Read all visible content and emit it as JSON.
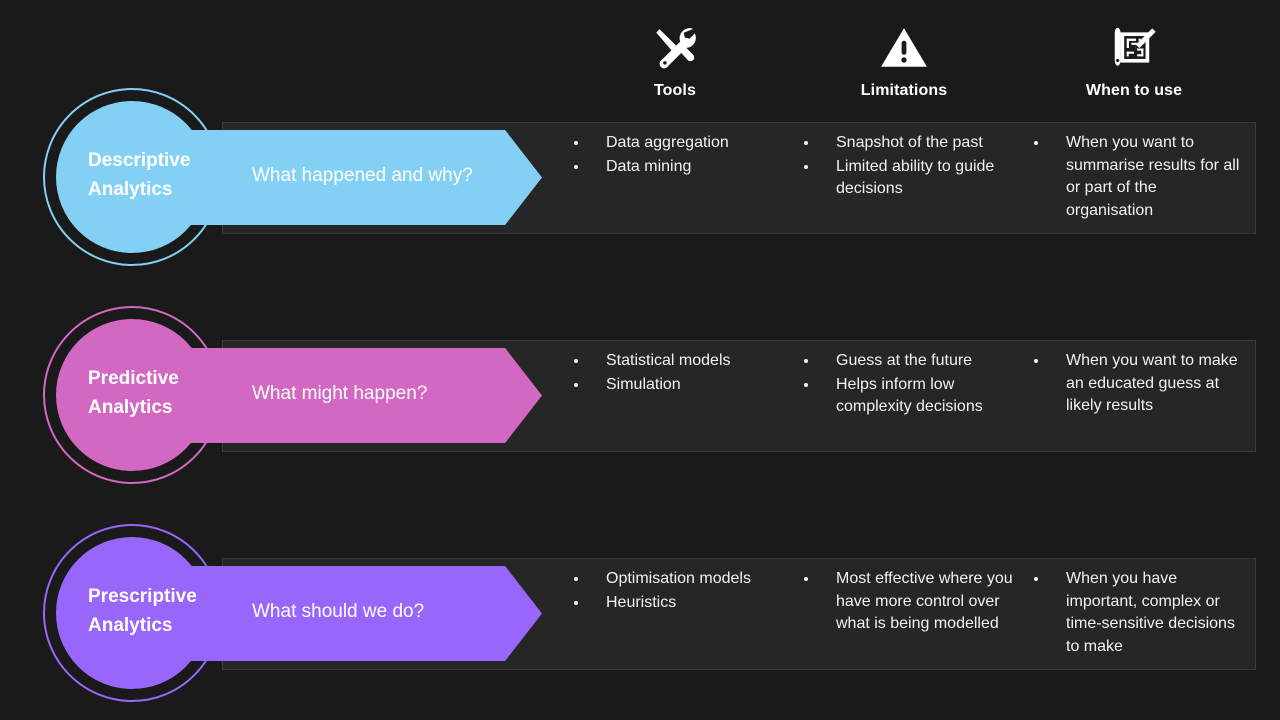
{
  "headers": [
    {
      "icon": "tools-icon",
      "label": "Tools"
    },
    {
      "icon": "warning-triangle-icon",
      "label": "Limitations"
    },
    {
      "icon": "blueprint-pencil-icon",
      "label": "When to use"
    }
  ],
  "rows": [
    {
      "title_line1": "Descriptive",
      "title_line2": "Analytics",
      "question": "What happened and why?",
      "color": "#84d0f5",
      "tools": [
        "Data aggregation",
        "Data mining"
      ],
      "limitations": [
        "Snapshot of the past",
        "Limited ability to guide decisions"
      ],
      "when_to_use": [
        "When you want to summarise results for all or part of the organisation"
      ]
    },
    {
      "title_line1": "Predictive",
      "title_line2": "Analytics",
      "question": "What might happen?",
      "color": "#d268c2",
      "tools": [
        "Statistical models",
        "Simulation"
      ],
      "limitations": [
        "Guess at the future",
        "Helps inform low complexity decisions"
      ],
      "when_to_use": [
        "When you want to make an educated guess at likely results"
      ]
    },
    {
      "title_line1": "Prescriptive",
      "title_line2": "Analytics",
      "question": "What should we do?",
      "color": "#9866fa",
      "tools": [
        "Optimisation models",
        "Heuristics"
      ],
      "limitations": [
        "Most effective where you have more control over what is being modelled"
      ],
      "when_to_use": [
        "When you have important, complex or time-sensitive decisions to make"
      ]
    }
  ],
  "colors": {
    "page_background": "#1a1a1a",
    "panel_background": "#262626",
    "panel_border": "#3b3b3b",
    "text": "#f2f2f2",
    "descriptive": "#84d0f5",
    "predictive": "#d268c2",
    "prescriptive": "#9866fa"
  }
}
